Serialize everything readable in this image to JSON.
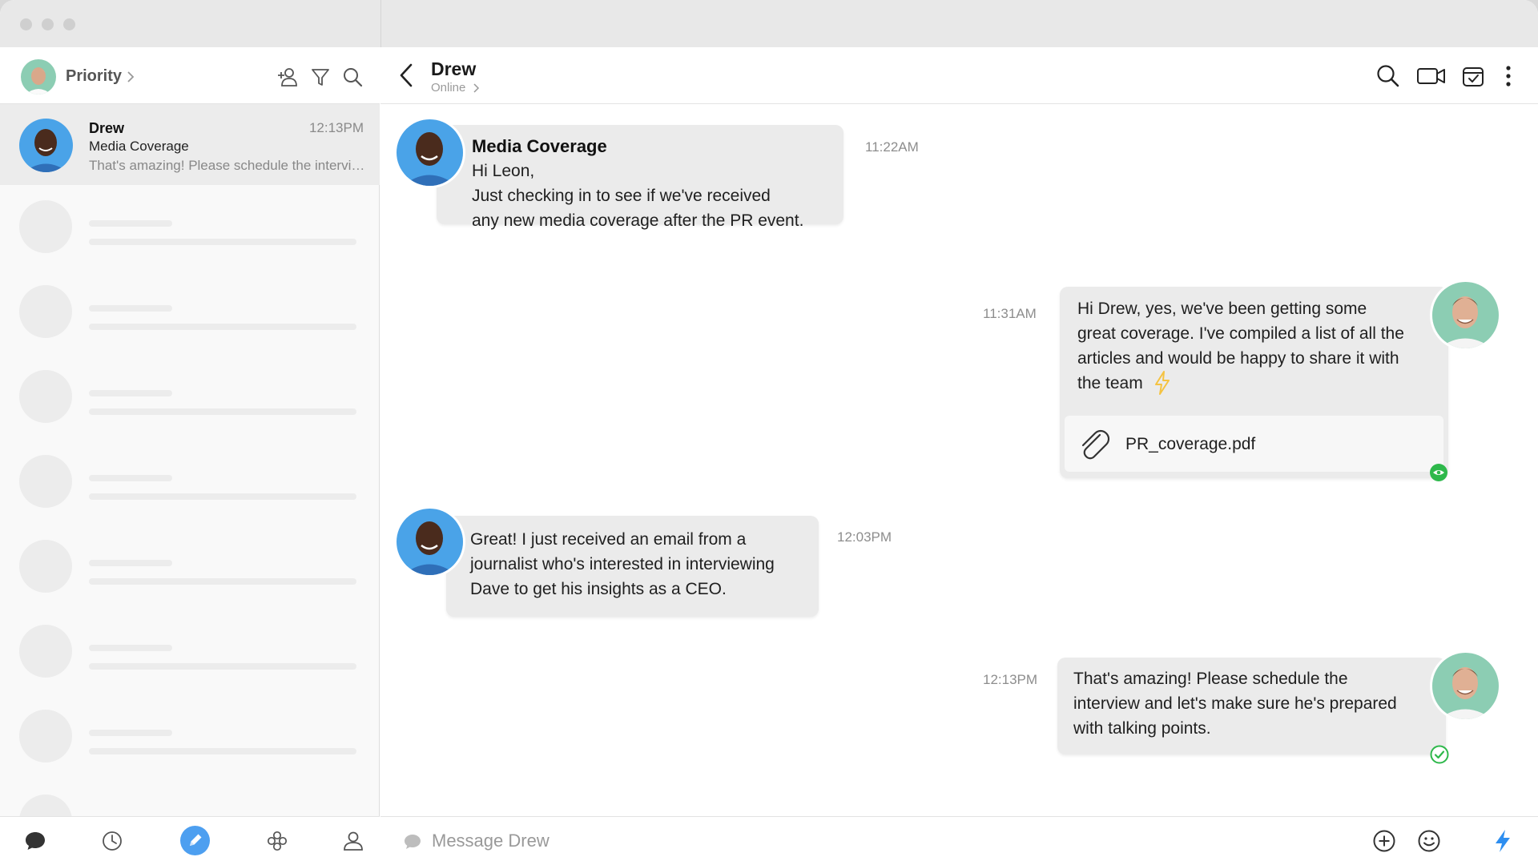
{
  "sidebar": {
    "title": "Priority",
    "conversation": {
      "name": "Drew",
      "time": "12:13PM",
      "subject": "Media Coverage",
      "preview": "That's amazing! Please schedule the interview and let's make sure he's prepared with talking points."
    }
  },
  "chat": {
    "contact_name": "Drew",
    "contact_status": "Online"
  },
  "messages": [
    {
      "subject": "Media Coverage",
      "lines": [
        "Hi Leon,",
        "Just checking in to see if we've received",
        "any new media coverage after the PR event."
      ],
      "time": "11:22AM"
    },
    {
      "lines": [
        "Hi Drew, yes, we've been getting some",
        "great coverage. I've compiled a list of all the",
        "articles and would be happy to share it with",
        "the team"
      ],
      "time": "11:31AM",
      "attachment": "PR_coverage.pdf"
    },
    {
      "lines": [
        "Great! I just received an email from a",
        "journalist who's interested in interviewing",
        "Dave to get his insights as a CEO."
      ],
      "time": "12:03PM"
    },
    {
      "lines": [
        "That's amazing! Please schedule the",
        "interview and let's make sure he's prepared",
        "with talking points."
      ],
      "time": "12:13PM"
    }
  ],
  "composer": {
    "placeholder": "Message Drew"
  },
  "colors": {
    "accent": "#4d9ff0",
    "online_green": "#2eb84b",
    "bubble": "#ebebeb",
    "lightning": "#f5c342"
  }
}
